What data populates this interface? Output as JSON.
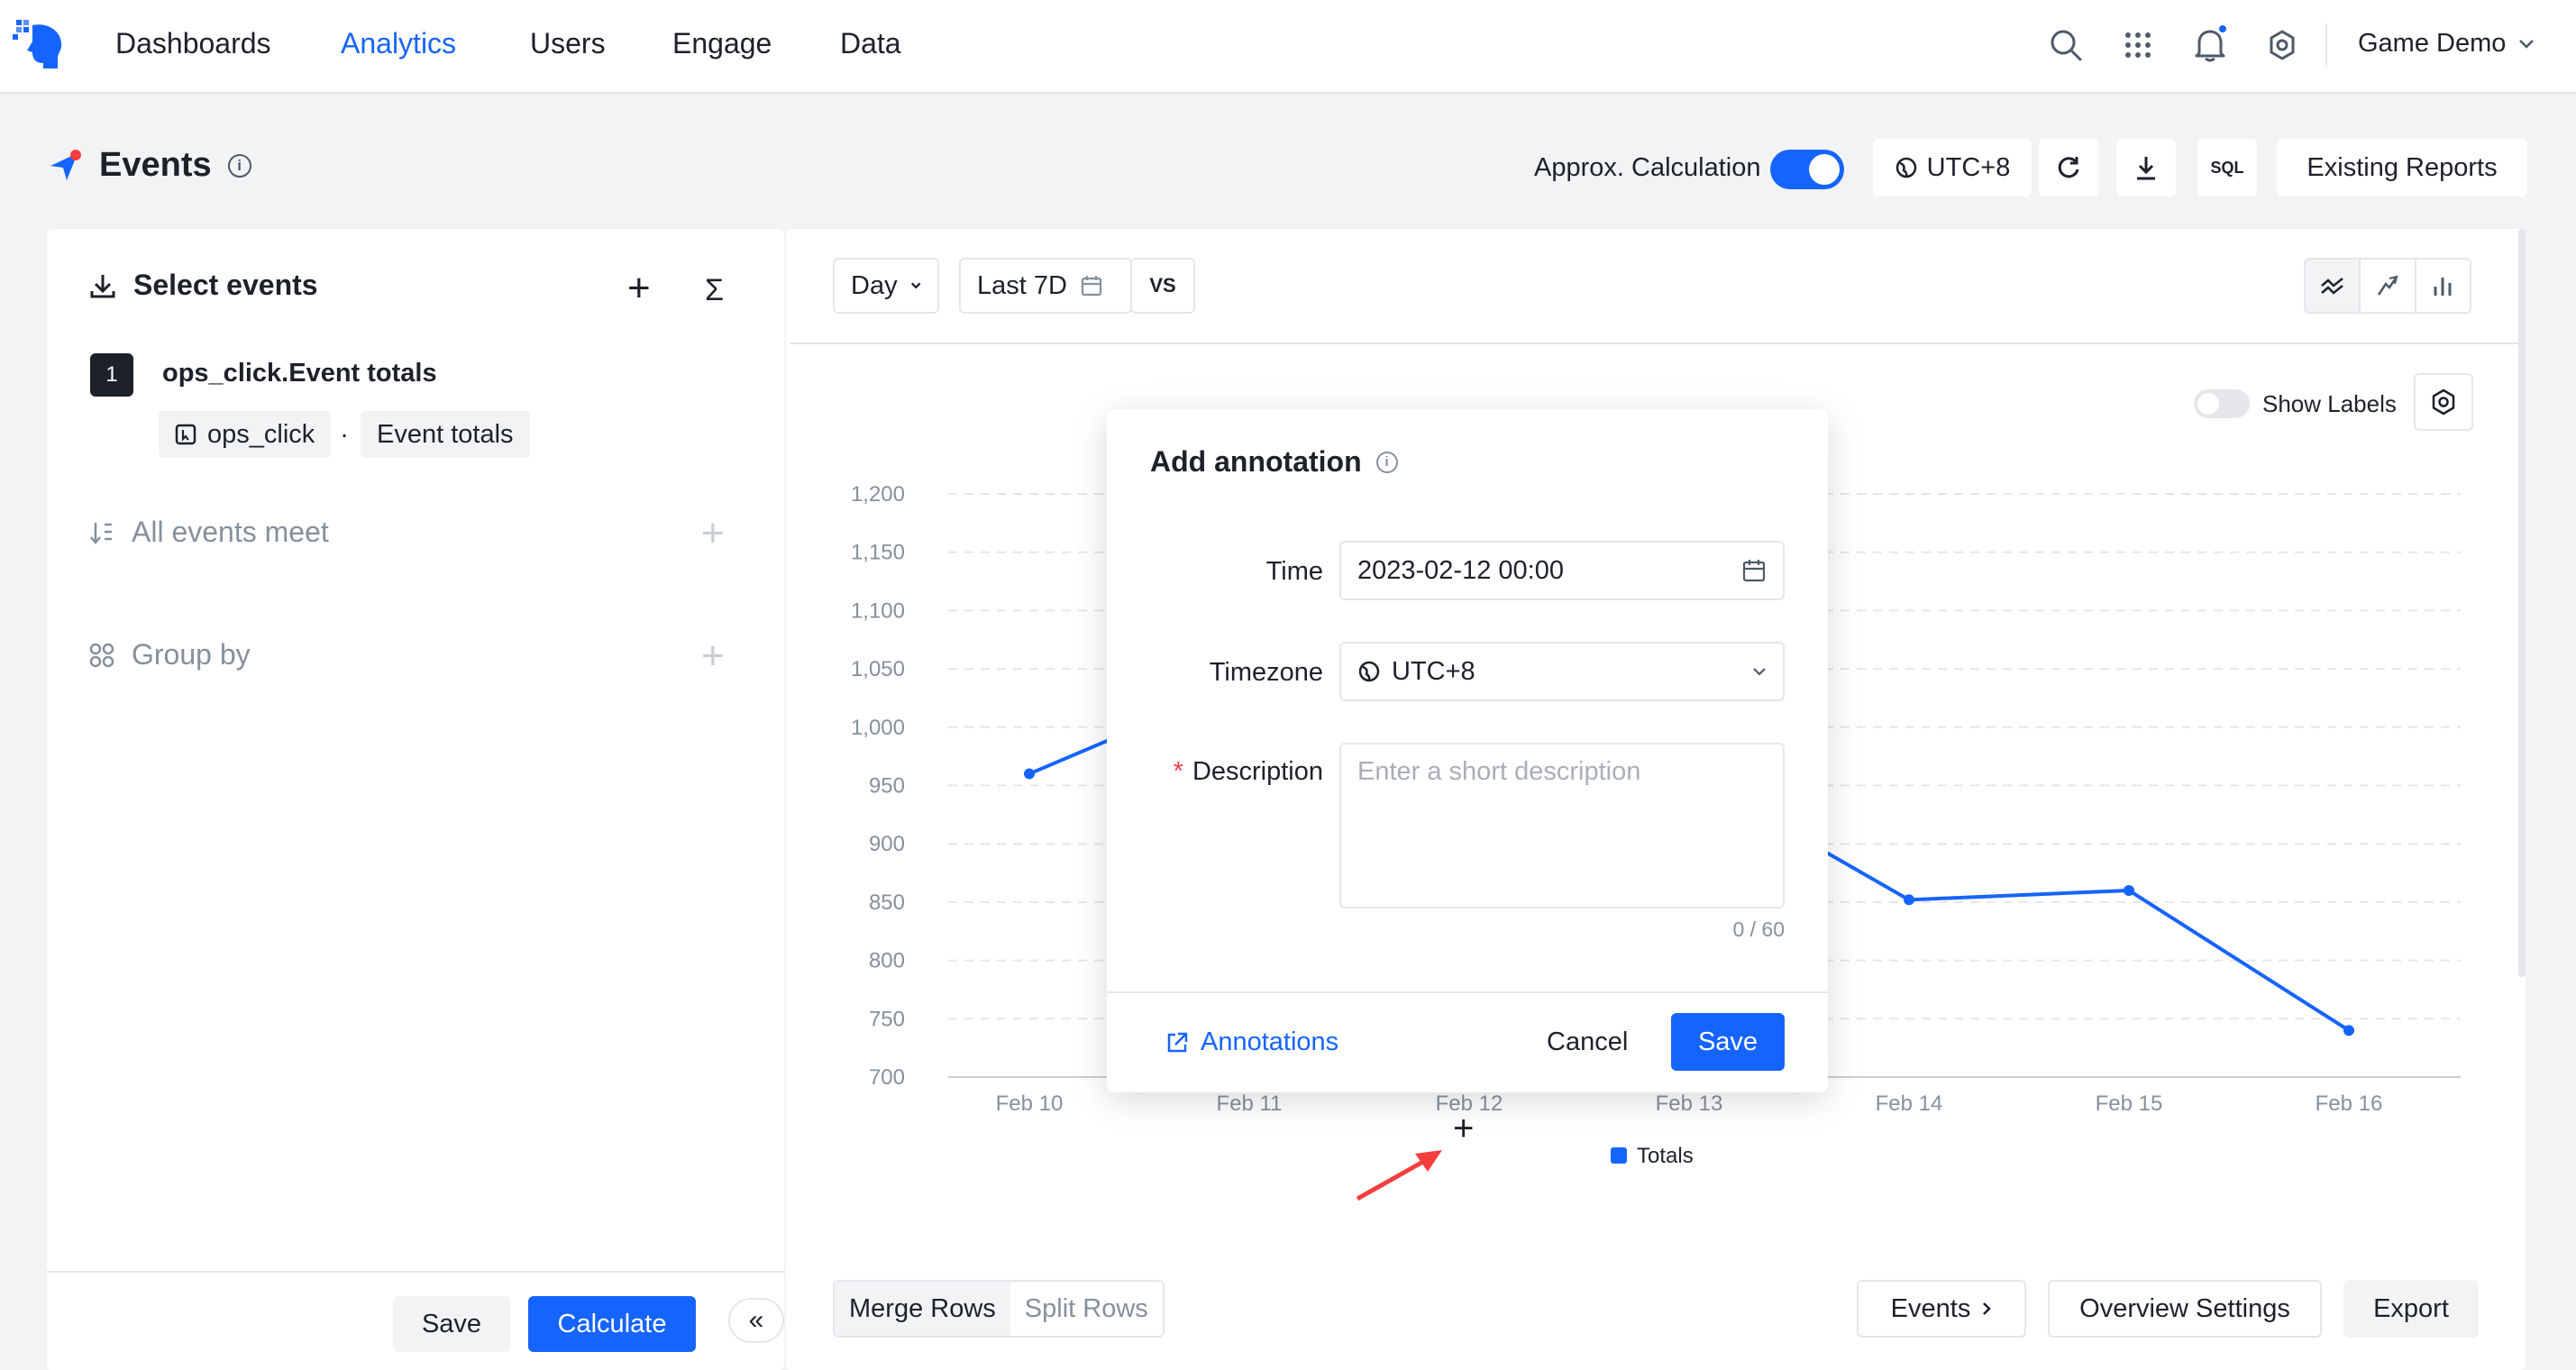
{
  "nav": {
    "items": [
      {
        "label": "Dashboards"
      },
      {
        "label": "Analytics"
      },
      {
        "label": "Users"
      },
      {
        "label": "Engage"
      },
      {
        "label": "Data"
      }
    ],
    "active": "Analytics",
    "project": "Game Demo",
    "icons": [
      "search-icon",
      "apps-grid-icon",
      "bell-icon",
      "gear-icon"
    ]
  },
  "header": {
    "title": "Events",
    "approx_label": "Approx. Calculation",
    "approx_on": true,
    "timezone": "UTC+8",
    "sql_label": "SQL",
    "existing_reports": "Existing Reports"
  },
  "left": {
    "select_events": "Select events",
    "event_index": "1",
    "event_name": "ops_click.Event totals",
    "chip_event": "ops_click",
    "chip_dot": ".",
    "chip_metric": "Event totals",
    "all_events_meet": "All events meet",
    "group_by": "Group by",
    "save": "Save",
    "calculate": "Calculate",
    "collapse": "«"
  },
  "toolbar": {
    "granularity": "Day",
    "range": "Last 7D",
    "vs": "VS",
    "show_labels": "Show Labels",
    "show_labels_on": false
  },
  "chart_data": {
    "type": "line",
    "categories": [
      "Feb 10",
      "Feb 11",
      "Feb 12",
      "Feb 13",
      "Feb 14",
      "Feb 15",
      "Feb 16"
    ],
    "series": [
      {
        "name": "Totals",
        "values": [
          960,
          1040,
          1100,
          960,
          852,
          860,
          740
        ]
      }
    ],
    "y_ticks": [
      "1,200",
      "1,150",
      "1,100",
      "1,050",
      "1,000",
      "950",
      "900",
      "850",
      "800",
      "750",
      "700"
    ],
    "ylim": [
      700,
      1200
    ],
    "grid": true,
    "legend": "bottom",
    "color": "#1664ff"
  },
  "bottom": {
    "merge_rows": "Merge Rows",
    "split_rows": "Split Rows",
    "events": "Events",
    "overview_settings": "Overview Settings",
    "export": "Export"
  },
  "modal": {
    "title": "Add annotation",
    "time_label": "Time",
    "time_value": "2023-02-12 00:00",
    "timezone_label": "Timezone",
    "timezone_value": "UTC+8",
    "description_label": "Description",
    "description_placeholder": "Enter a short description",
    "counter": "0 / 60",
    "annotations_link": "Annotations",
    "cancel": "Cancel",
    "save": "Save"
  }
}
